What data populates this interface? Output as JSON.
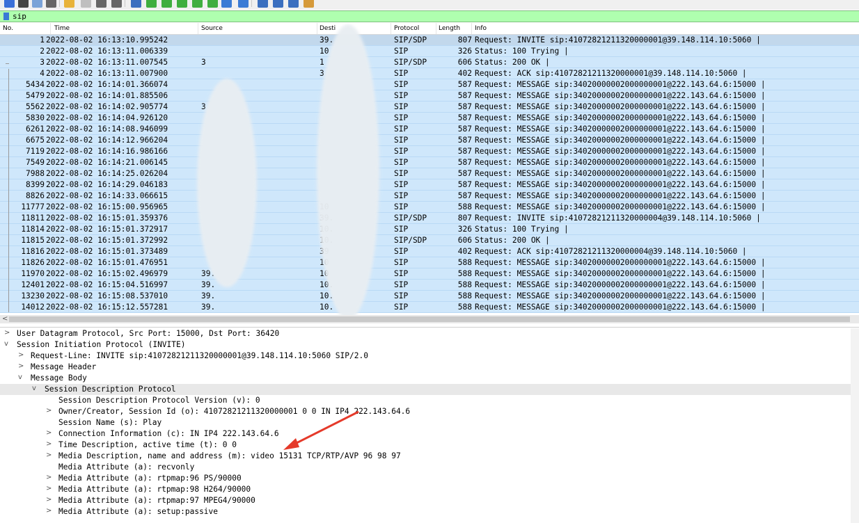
{
  "toolbar": {
    "buttons": [
      {
        "icon": "shark-fin-start-icon",
        "color": "#3a6fd8"
      },
      {
        "icon": "stop-square-icon",
        "color": "#444444"
      },
      {
        "icon": "restart-capture-icon",
        "color": "#7aa3d8"
      },
      {
        "icon": "capture-options-gear-icon",
        "color": "#666666"
      },
      {
        "icon": "open-folder-icon",
        "color": "#e8b33a"
      },
      {
        "icon": "save-file-icon",
        "color": "#bfbfbf"
      },
      {
        "icon": "close-file-icon",
        "color": "#666666"
      },
      {
        "icon": "reload-icon",
        "color": "#666666"
      },
      {
        "icon": "find-packet-icon",
        "color": "#3b6fbf"
      },
      {
        "icon": "go-back-icon",
        "color": "#3fae3f"
      },
      {
        "icon": "go-forward-icon",
        "color": "#3fae3f"
      },
      {
        "icon": "go-to-packet-icon",
        "color": "#3fae3f"
      },
      {
        "icon": "first-packet-icon",
        "color": "#3fae3f"
      },
      {
        "icon": "last-packet-icon",
        "color": "#3fae3f"
      },
      {
        "icon": "autoscroll-icon",
        "color": "#3a7bd5"
      },
      {
        "icon": "colorize-icon",
        "color": "#3a7bd5"
      },
      {
        "icon": "zoom-in-icon",
        "color": "#3b6fbf"
      },
      {
        "icon": "zoom-out-icon",
        "color": "#3b6fbf"
      },
      {
        "icon": "normal-size-icon",
        "color": "#3b6fbf"
      },
      {
        "icon": "resize-columns-icon",
        "color": "#d69a3a"
      }
    ]
  },
  "filter": {
    "value": "sip",
    "background": "#afffaf"
  },
  "columns": {
    "no": "No.",
    "time": "Time",
    "source": "Source",
    "destination": "Desti",
    "protocol": "Protocol",
    "length": "Length",
    "info": "Info"
  },
  "packets": [
    {
      "no": "1",
      "time": "2022-08-02 16:13:10.995242",
      "src": "",
      "dst": "39.",
      "proto": "SIP/SDP",
      "len": "807",
      "info": "Request: INVITE sip:41072821211320000001@39.148.114.10:5060 |"
    },
    {
      "no": "2",
      "time": "2022-08-02 16:13:11.006339",
      "src": "",
      "dst": "10",
      "proto": "SIP",
      "len": "326",
      "info": "Status: 100 Trying |"
    },
    {
      "no": "3",
      "time": "2022-08-02 16:13:11.007545",
      "src": "3",
      "dst": "1",
      "proto": "SIP/SDP",
      "len": "606",
      "info": "Status: 200 OK |"
    },
    {
      "no": "4",
      "time": "2022-08-02 16:13:11.007900",
      "src": "",
      "dst": "3",
      "proto": "SIP",
      "len": "402",
      "info": "Request: ACK sip:41072821211320000001@39.148.114.10:5060 |"
    },
    {
      "no": "5434",
      "time": "2022-08-02 16:14:01.366074",
      "src": "",
      "dst": "",
      "proto": "SIP",
      "len": "587",
      "info": "Request: MESSAGE sip:34020000002000000001@222.143.64.6:15000 |"
    },
    {
      "no": "5479",
      "time": "2022-08-02 16:14:01.885506",
      "src": "",
      "dst": "",
      "proto": "SIP",
      "len": "587",
      "info": "Request: MESSAGE sip:34020000002000000001@222.143.64.6:15000 |"
    },
    {
      "no": "5562",
      "time": "2022-08-02 16:14:02.905774",
      "src": "3",
      "dst": "",
      "proto": "SIP",
      "len": "587",
      "info": "Request: MESSAGE sip:34020000002000000001@222.143.64.6:15000 |"
    },
    {
      "no": "5830",
      "time": "2022-08-02 16:14:04.926120",
      "src": "",
      "dst": "",
      "proto": "SIP",
      "len": "587",
      "info": "Request: MESSAGE sip:34020000002000000001@222.143.64.6:15000 |"
    },
    {
      "no": "6261",
      "time": "2022-08-02 16:14:08.946099",
      "src": "",
      "dst": "",
      "proto": "SIP",
      "len": "587",
      "info": "Request: MESSAGE sip:34020000002000000001@222.143.64.6:15000 |"
    },
    {
      "no": "6675",
      "time": "2022-08-02 16:14:12.966204",
      "src": "",
      "dst": "",
      "proto": "SIP",
      "len": "587",
      "info": "Request: MESSAGE sip:34020000002000000001@222.143.64.6:15000 |"
    },
    {
      "no": "7119",
      "time": "2022-08-02 16:14:16.986166",
      "src": "",
      "dst": "",
      "proto": "SIP",
      "len": "587",
      "info": "Request: MESSAGE sip:34020000002000000001@222.143.64.6:15000 |"
    },
    {
      "no": "7549",
      "time": "2022-08-02 16:14:21.006145",
      "src": "",
      "dst": "",
      "proto": "SIP",
      "len": "587",
      "info": "Request: MESSAGE sip:34020000002000000001@222.143.64.6:15000 |"
    },
    {
      "no": "7988",
      "time": "2022-08-02 16:14:25.026204",
      "src": "",
      "dst": "",
      "proto": "SIP",
      "len": "587",
      "info": "Request: MESSAGE sip:34020000002000000001@222.143.64.6:15000 |"
    },
    {
      "no": "8399",
      "time": "2022-08-02 16:14:29.046183",
      "src": "",
      "dst": "",
      "proto": "SIP",
      "len": "587",
      "info": "Request: MESSAGE sip:34020000002000000001@222.143.64.6:15000 |"
    },
    {
      "no": "8826",
      "time": "2022-08-02 16:14:33.066615",
      "src": "",
      "dst": "",
      "proto": "SIP",
      "len": "587",
      "info": "Request: MESSAGE sip:34020000002000000001@222.143.64.6:15000 |"
    },
    {
      "no": "11777",
      "time": "2022-08-02 16:15:00.956965",
      "src": "",
      "dst": "10",
      "proto": "SIP",
      "len": "588",
      "info": "Request: MESSAGE sip:34020000002000000001@222.143.64.6:15000 |"
    },
    {
      "no": "11811",
      "time": "2022-08-02 16:15:01.359376",
      "src": "",
      "dst": "39.",
      "proto": "SIP/SDP",
      "len": "807",
      "info": "Request: INVITE sip:41072821211320000004@39.148.114.10:5060 |"
    },
    {
      "no": "11814",
      "time": "2022-08-02 16:15:01.372917",
      "src": "",
      "dst": "10.",
      "proto": "SIP",
      "len": "326",
      "info": "Status: 100 Trying |"
    },
    {
      "no": "11815",
      "time": "2022-08-02 16:15:01.372992",
      "src": "",
      "dst": "10.",
      "proto": "SIP/SDP",
      "len": "606",
      "info": "Status: 200 OK |"
    },
    {
      "no": "11816",
      "time": "2022-08-02 16:15:01.373489",
      "src": "",
      "dst": "39",
      "proto": "SIP",
      "len": "402",
      "info": "Request: ACK sip:41072821211320000004@39.148.114.10:5060 |"
    },
    {
      "no": "11826",
      "time": "2022-08-02 16:15:01.476951",
      "src": "",
      "dst": "10",
      "proto": "SIP",
      "len": "588",
      "info": "Request: MESSAGE sip:34020000002000000001@222.143.64.6:15000 |"
    },
    {
      "no": "11970",
      "time": "2022-08-02 16:15:02.496979",
      "src": "39.",
      "dst": "10",
      "proto": "SIP",
      "len": "588",
      "info": "Request: MESSAGE sip:34020000002000000001@222.143.64.6:15000 |"
    },
    {
      "no": "12401",
      "time": "2022-08-02 16:15:04.516997",
      "src": "39.",
      "dst": "10.",
      "proto": "SIP",
      "len": "588",
      "info": "Request: MESSAGE sip:34020000002000000001@222.143.64.6:15000 |"
    },
    {
      "no": "13230",
      "time": "2022-08-02 16:15:08.537010",
      "src": "39.",
      "dst": "10.",
      "proto": "SIP",
      "len": "588",
      "info": "Request: MESSAGE sip:34020000002000000001@222.143.64.6:15000 |"
    },
    {
      "no": "14012",
      "time": "2022-08-02 16:15:12.557281",
      "src": "39.",
      "dst": "10.",
      "proto": "SIP",
      "len": "588",
      "info": "Request: MESSAGE sip:34020000002000000001@222.143.64.6:15000 |"
    }
  ],
  "details": [
    {
      "toggle": ">",
      "text": "User Datagram Protocol, Src Port: 15000, Dst Port: 36420"
    },
    {
      "toggle": "v",
      "text": "Session Initiation Protocol (INVITE)"
    },
    {
      "toggle": ">",
      "text": "Request-Line: INVITE sip:41072821211320000001@39.148.114.10:5060 SIP/2.0"
    },
    {
      "toggle": ">",
      "text": "Message Header"
    },
    {
      "toggle": "v",
      "text": "Message Body"
    },
    {
      "toggle": "v",
      "text": "Session Description Protocol"
    },
    {
      "toggle": "",
      "text": "Session Description Protocol Version (v): 0"
    },
    {
      "toggle": ">",
      "text": "Owner/Creator, Session Id (o): 41072821211320000001 0 0 IN IP4 222.143.64.6"
    },
    {
      "toggle": "",
      "text": "Session Name (s): Play"
    },
    {
      "toggle": ">",
      "text": "Connection Information (c): IN IP4 222.143.64.6"
    },
    {
      "toggle": ">",
      "text": "Time Description, active time (t): 0 0"
    },
    {
      "toggle": ">",
      "text": "Media Description, name and address (m): video 15131 TCP/RTP/AVP 96 98 97"
    },
    {
      "toggle": "",
      "text": "Media Attribute (a): recvonly"
    },
    {
      "toggle": ">",
      "text": "Media Attribute (a): rtpmap:96 PS/90000"
    },
    {
      "toggle": ">",
      "text": "Media Attribute (a): rtpmap:98 H264/90000"
    },
    {
      "toggle": ">",
      "text": "Media Attribute (a): rtpmap:97 MPEG4/90000"
    },
    {
      "toggle": ">",
      "text": "Media Attribute (a): setup:passive"
    }
  ],
  "colors": {
    "row_bg": "#cfe7fb",
    "selected_row_bg": "#c2d8ec",
    "annotation_arrow": "#e53a2a"
  }
}
